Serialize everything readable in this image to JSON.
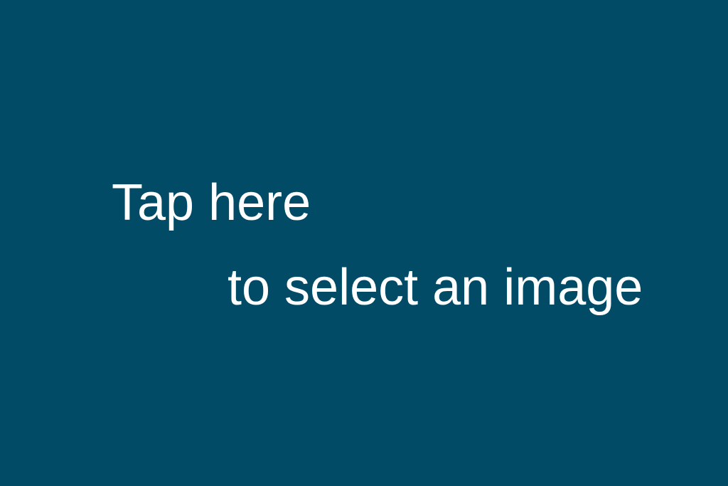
{
  "prompt": {
    "line1": "Tap here",
    "line2": "to select an image"
  },
  "colors": {
    "background": "#024b66",
    "text": "#ffffff"
  }
}
